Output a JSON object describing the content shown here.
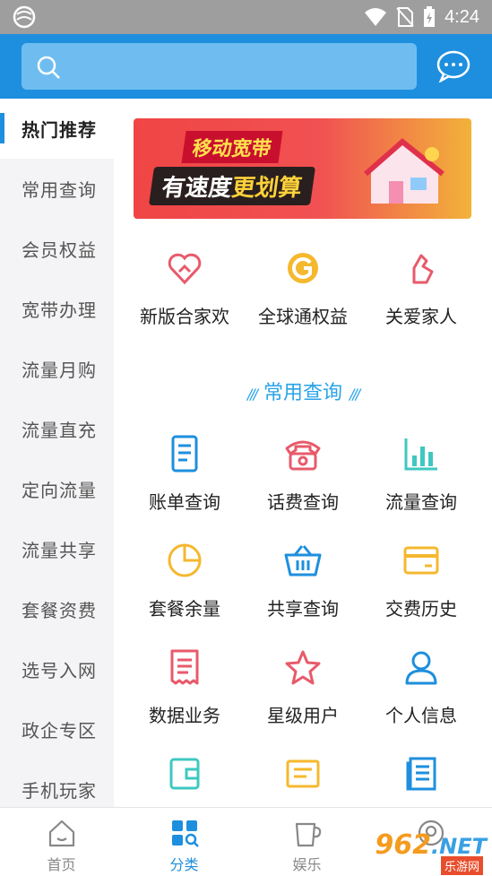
{
  "status_bar": {
    "time": "4:24"
  },
  "header": {
    "search_placeholder": ""
  },
  "sidebar": {
    "items": [
      {
        "label": "热门推荐",
        "active": true
      },
      {
        "label": "常用查询"
      },
      {
        "label": "会员权益"
      },
      {
        "label": "宽带办理"
      },
      {
        "label": "流量月购"
      },
      {
        "label": "流量直充"
      },
      {
        "label": "定向流量"
      },
      {
        "label": "流量共享"
      },
      {
        "label": "套餐资费"
      },
      {
        "label": "选号入网"
      },
      {
        "label": "政企专区"
      },
      {
        "label": "手机玩家"
      }
    ]
  },
  "banner": {
    "line1": "移动宽带",
    "line2_a": "有速度",
    "line2_b": "更划算"
  },
  "hot_items": [
    {
      "label": "新版合家欢",
      "icon": "heart-home-icon"
    },
    {
      "label": "全球通权益",
      "icon": "globe-g-icon"
    },
    {
      "label": "关爱家人",
      "icon": "finger-heart-icon"
    }
  ],
  "section": {
    "title": "常用查询"
  },
  "query_items": [
    {
      "label": "账单查询",
      "icon": "bill-icon"
    },
    {
      "label": "话费查询",
      "icon": "phone-icon"
    },
    {
      "label": "流量查询",
      "icon": "bar-chart-icon"
    },
    {
      "label": "套餐余量",
      "icon": "pie-chart-icon"
    },
    {
      "label": "共享查询",
      "icon": "basket-icon"
    },
    {
      "label": "交费历史",
      "icon": "card-icon"
    },
    {
      "label": "数据业务",
      "icon": "document-icon"
    },
    {
      "label": "星级用户",
      "icon": "star-icon"
    },
    {
      "label": "个人信息",
      "icon": "person-icon"
    }
  ],
  "bottom_tabs": [
    {
      "label": "首页",
      "icon": "home-icon"
    },
    {
      "label": "分类",
      "icon": "category-icon",
      "active": true
    },
    {
      "label": "娱乐",
      "icon": "cup-icon"
    },
    {
      "label": "",
      "icon": "avatar-icon"
    }
  ],
  "watermark": {
    "text": "962",
    "net": ".NET",
    "sub": "乐游网"
  },
  "colors": {
    "primary": "#1e8fde",
    "accent_red": "#e85a6b",
    "accent_yellow": "#f5b82e",
    "accent_teal": "#3ec8c0"
  }
}
